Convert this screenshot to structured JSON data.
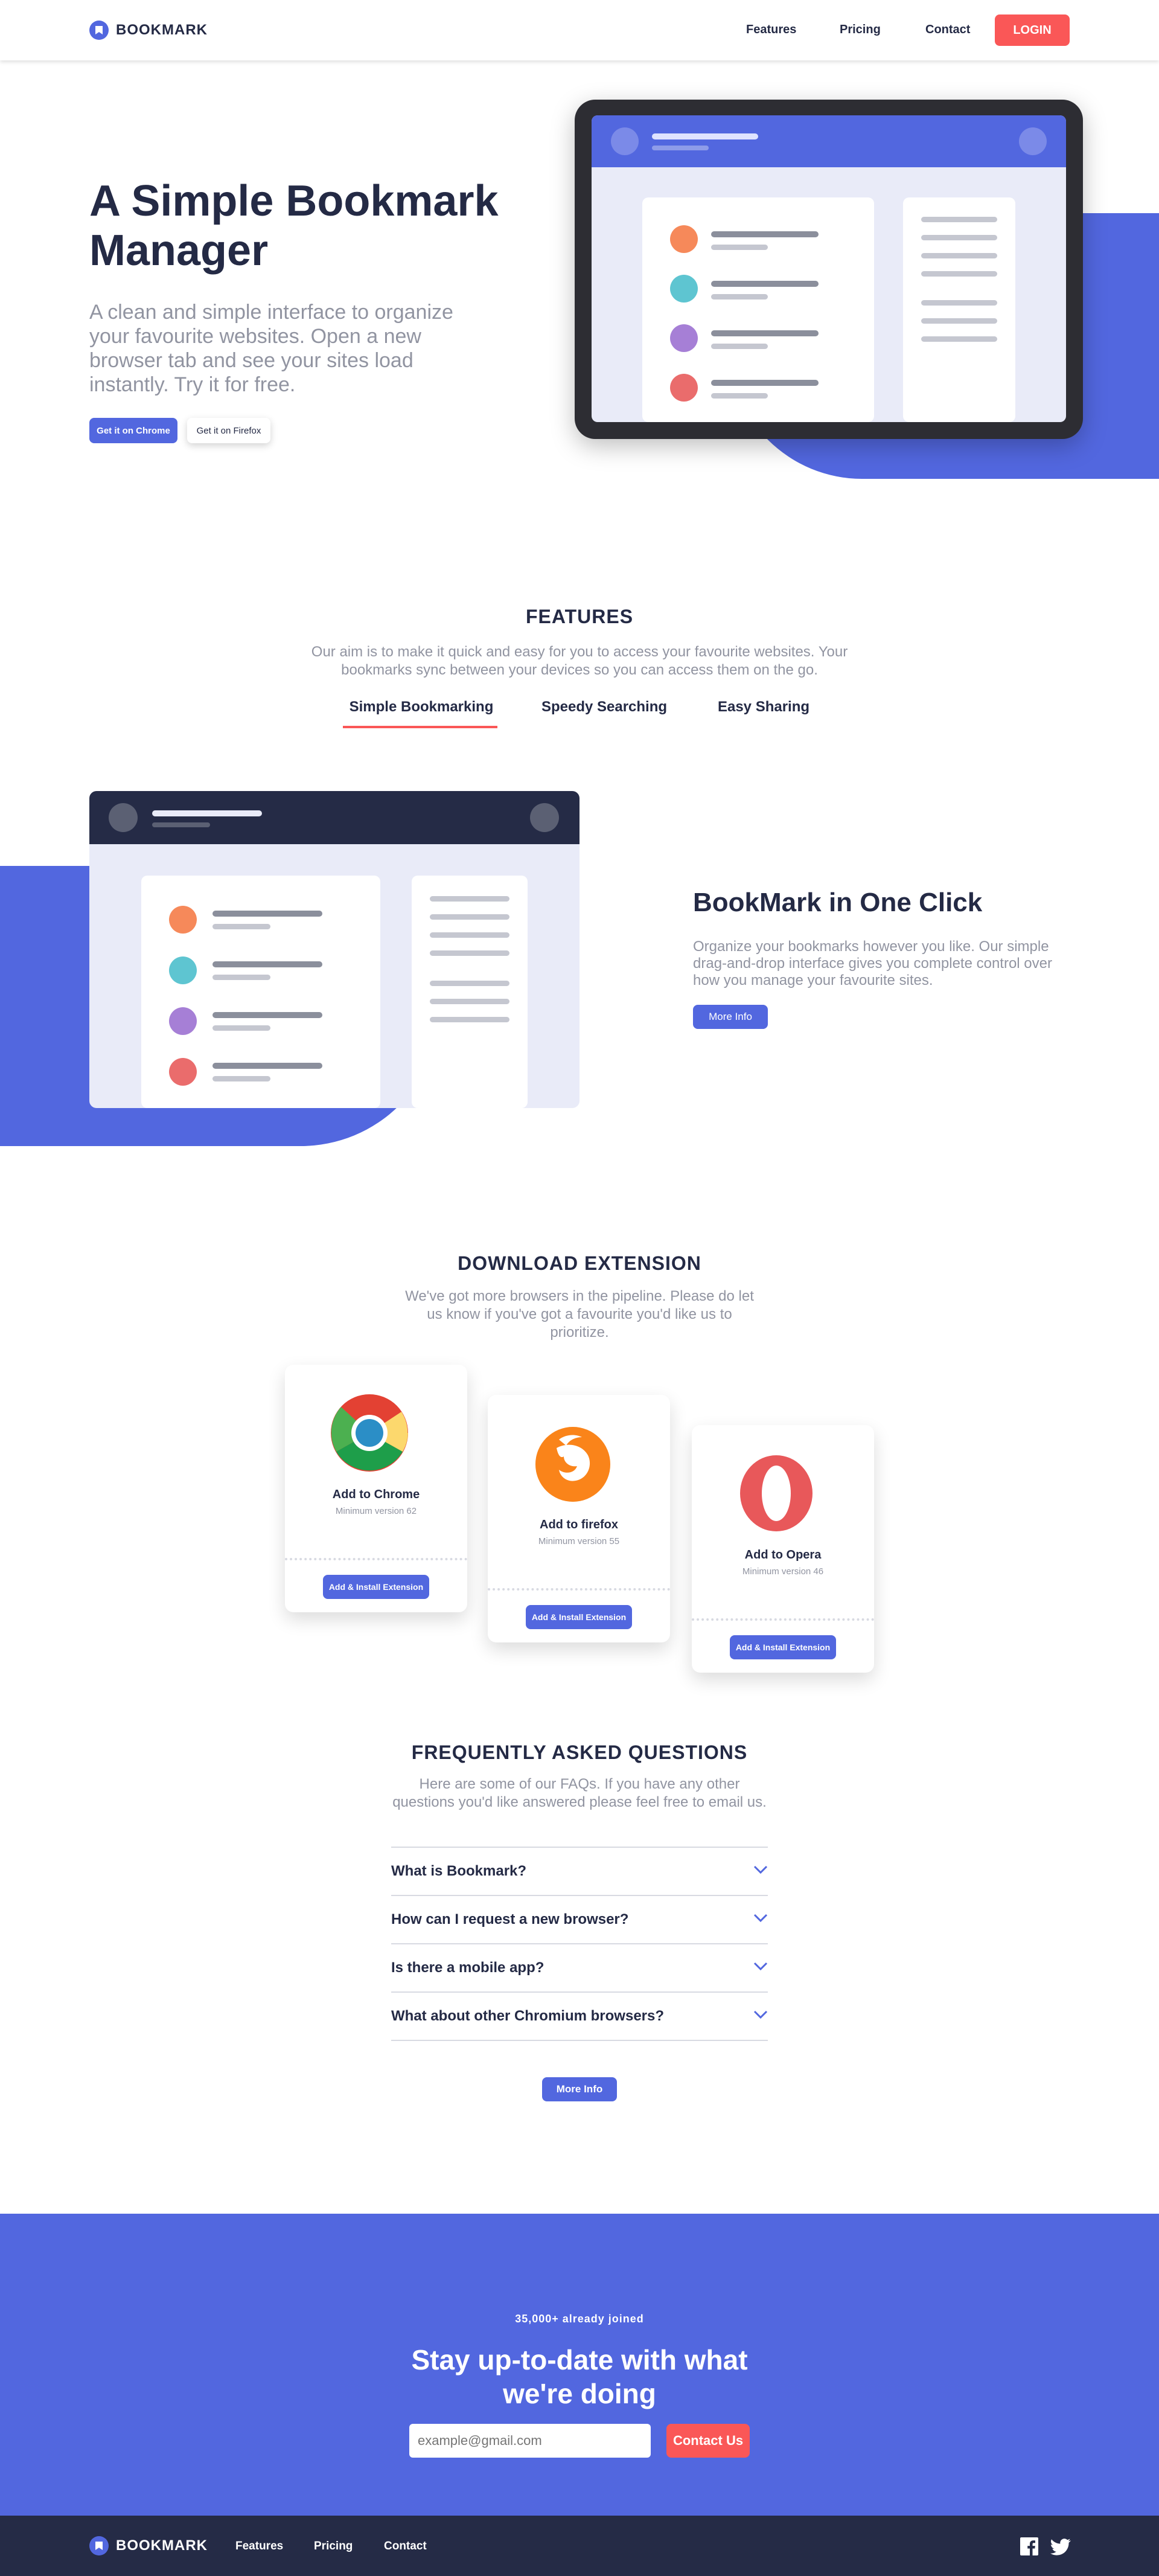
{
  "header": {
    "brand": "BOOKMARK",
    "nav": [
      "Features",
      "Pricing",
      "Contact"
    ],
    "login": "LOGIN"
  },
  "hero": {
    "title": "A Simple Bookmark Manager",
    "text": "A clean and simple interface to organize your favourite websites. Open a new browser tab and see your sites load instantly. Try it for free.",
    "chrome_button": "Get it on Chrome",
    "firefox_button": "Get it on Firefox"
  },
  "features": {
    "title": "FEATURES",
    "text": "Our aim is to make it quick and easy for you to access your favourite websites. Your bookmarks sync between your devices so you can access them on the go.",
    "tabs": [
      "Simple Bookmarking",
      "Speedy Searching",
      "Easy Sharing"
    ],
    "active_tab": "Simple Bookmarking",
    "panel_title": "BookMark in One Click",
    "panel_text": "Organize your bookmarks however you like. Our simple drag-and-drop interface gives you complete control over how you manage your favourite sites.",
    "panel_button": "More Info"
  },
  "download": {
    "title": "DOWNLOAD EXTENSION",
    "text": "We've got more browsers in the pipeline. Please do let us know if you've got a favourite you'd like us to prioritize.",
    "cards": [
      {
        "name": "Add to Chrome",
        "min": "Minimum version 62",
        "button": "Add & Install Extension",
        "icon": "chrome-icon"
      },
      {
        "name": "Add to firefox",
        "min": "Minimum version 55",
        "button": "Add & Install Extension",
        "icon": "firefox-icon"
      },
      {
        "name": "Add to Opera",
        "min": "Minimum version 46",
        "button": "Add & Install Extension",
        "icon": "opera-icon"
      }
    ]
  },
  "faq": {
    "title": "FREQUENTLY ASKED QUESTIONS",
    "text": "Here are some of our FAQs. If you have any other questions you'd like answered please feel free to email us.",
    "questions": [
      "What is Bookmark?",
      "How can I request a new browser?",
      "Is there a mobile app?",
      "What about other Chromium browsers?"
    ],
    "button": "More Info"
  },
  "cta": {
    "joined": "35,000+ already joined",
    "title": "Stay up-to-date with what we're doing",
    "email_placeholder": "example@gmail.com",
    "button": "Contact Us"
  },
  "footer": {
    "brand": "BOOKMARK",
    "nav": [
      "Features",
      "Pricing",
      "Contact"
    ],
    "social": [
      "facebook-icon",
      "twitter-icon"
    ]
  },
  "colors": {
    "primary": "#5267df",
    "accent": "#fa5757",
    "dark": "#242a45",
    "footer": "#252b46",
    "muted": "#9194a1"
  }
}
